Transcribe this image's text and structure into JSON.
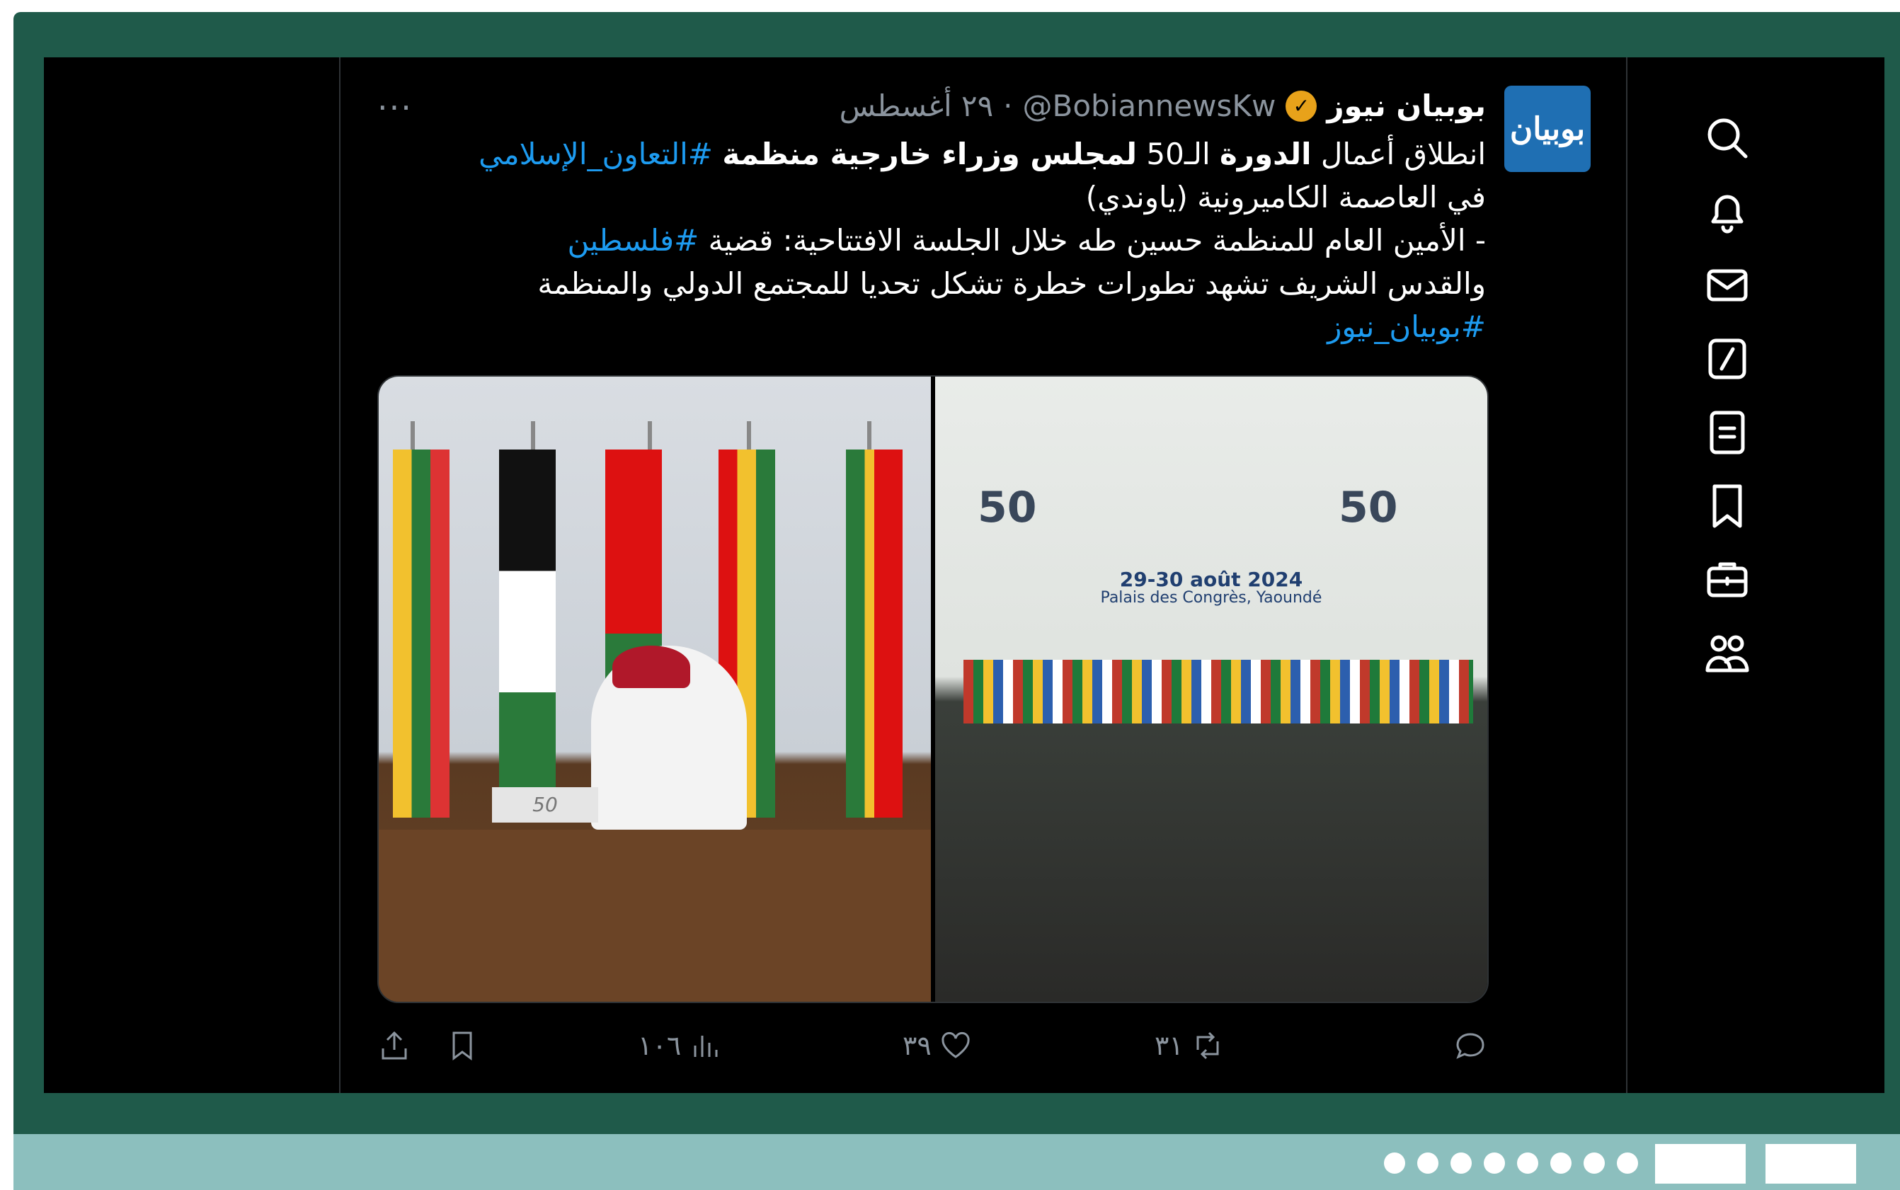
{
  "tweet": {
    "display_name": "بوبيان نيوز",
    "handle": "@BobiannewsKw",
    "separator": "·",
    "date": "٢٩ أغسطس",
    "avatar_text": "بوبيان",
    "more": "···",
    "line1_a": "انطلاق أعمال ",
    "line1_b": "الدورة",
    "line1_c": " الـ50 ",
    "line1_d": "لمجلس وزراء خارجية منظمة",
    "line1_hash": " #التعاون_الإسلامي",
    "line2": "في العاصمة الكاميرونية (ياوندي)",
    "line3_a": "- الأمين العام للمنظمة حسين طه خلال الجلسة الافتتاحية: قضية ",
    "line3_hash": "#فلسطين",
    "line4": "والقدس الشريف تشهد تطورات خطرة تشكل تحديا للمجتمع الدولي والمنظمة",
    "line5_hash": "#بوبيان_نيوز"
  },
  "media": {
    "left_plate": "50",
    "right_banner_date": "29-30 août 2024",
    "right_banner_place": "Palais des Congrès, Yaoundé",
    "logo_text": "50"
  },
  "actions": {
    "views": "١٠٦",
    "likes": "٣٩",
    "retweets": "٣١"
  },
  "icons": [
    "search-icon",
    "bell-icon",
    "mail-icon",
    "compose-icon",
    "list-icon",
    "bookmark-icon",
    "briefcase-icon",
    "people-icon"
  ],
  "colors": {
    "frame": "#1f5a4a",
    "link": "#1d9bf0",
    "bar": "#8cbfbe"
  }
}
